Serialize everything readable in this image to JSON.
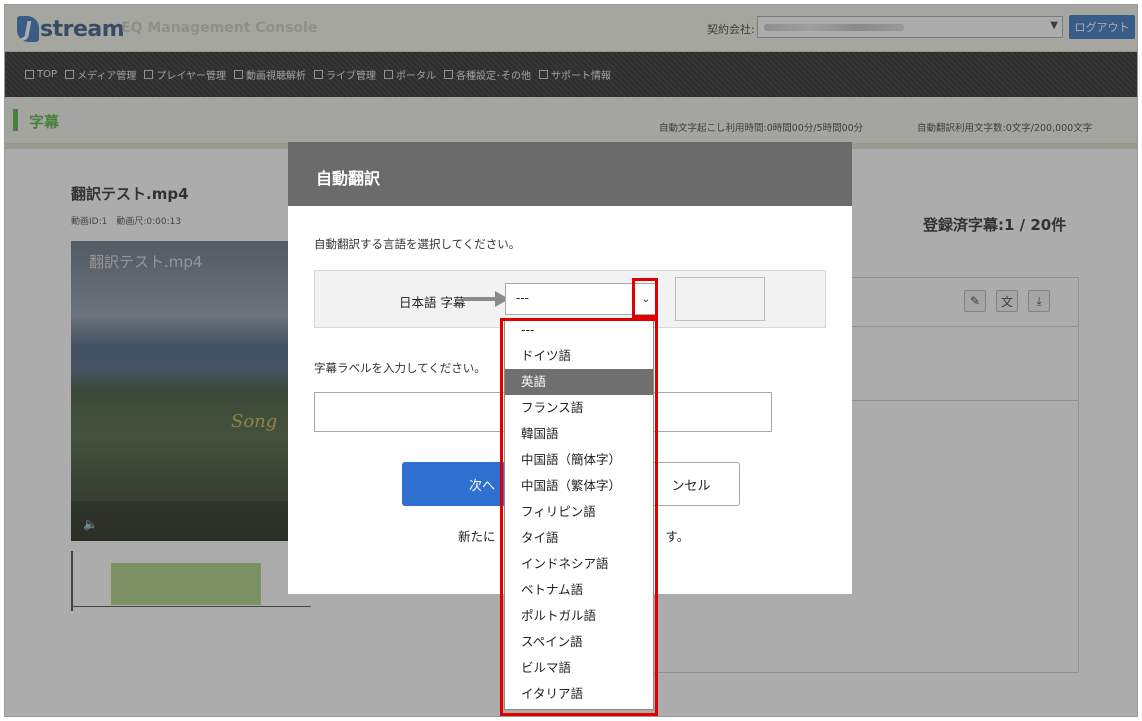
{
  "header": {
    "logo_text": "stream",
    "logo_letter": "J",
    "app_title": "EQ Management Console",
    "company_label": "契約会社:",
    "logout_label": "ログアウト"
  },
  "nav": {
    "items": [
      "TOP",
      "メディア管理",
      "プレイヤー管理",
      "動画視聴解析",
      "ライブ管理",
      "ポータル",
      "各種設定･その他",
      "サポート情報"
    ]
  },
  "page": {
    "title": "字幕",
    "usage_transcription": "自動文字起こし利用時間:0時間00分/5時間00分",
    "usage_translation": "自動翻訳利用文字数:0文字/200,000文字"
  },
  "media": {
    "filename": "翻訳テスト.mp4",
    "info": "動画ID:1　動画尺:0:00:13",
    "video_title": "翻訳テスト.mp4",
    "video_overlay_text": "Song",
    "registered": "登録済字幕:1 / 20件"
  },
  "modal": {
    "title": "自動翻訳",
    "instruction_language": "自動翻訳する言語を選択してください。",
    "source_label": "日本語 字幕",
    "selected_value": "---",
    "instruction_label": "字幕ラベルを入力してください。",
    "label_value": "",
    "next_label": "次へ",
    "cancel_label": "ンセル",
    "note_left": "新たに",
    "note_right": "す。",
    "note_line2": "（"
  },
  "dropdown": {
    "options": [
      "---",
      "ドイツ語",
      "英語",
      "フランス語",
      "韓国語",
      "中国語（簡体字）",
      "中国語（繁体字）",
      "フィリピン語",
      "タイ語",
      "インドネシア語",
      "ベトナム語",
      "ポルトガル語",
      "スペイン語",
      "ビルマ語",
      "イタリア語"
    ],
    "highlighted": "英語"
  },
  "colors": {
    "accent_green": "#4bb03a",
    "button_blue": "#2f6fd0",
    "highlight_red": "#e00000",
    "modal_header": "#6b6b6b"
  }
}
